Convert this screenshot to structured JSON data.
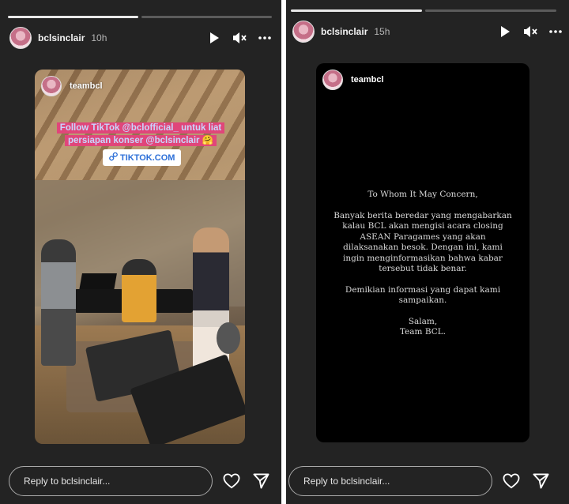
{
  "stories": {
    "left": {
      "username": "bclsinclair",
      "time": "10h",
      "progress_segments_done": 1,
      "progress_segments_total": 2,
      "media": {
        "inner_username": "teambcl",
        "caption_line1": "Follow TikTok @bclofficial_ untuk liat",
        "caption_line2": "persiapan konser @bclsinclair 🤗",
        "link_label": "TIKTOK.COM"
      },
      "reply_placeholder": "Reply to bclsinclair..."
    },
    "right": {
      "username": "bclsinclair",
      "time": "15h",
      "progress_segments_done": 1,
      "progress_segments_total": 2,
      "media": {
        "inner_username": "teambcl",
        "greeting": "To Whom It May Concern,",
        "paragraph1": "Banyak berita beredar yang mengabarkan kalau BCL akan mengisi acara closing ASEAN Paragames yang akan dilaksanakan besok. Dengan ini, kami ingin menginformasikan bahwa kabar tersebut tidak benar.",
        "paragraph2": "Demikian informasi yang dapat kami sampaikan.",
        "closing1": "Salam,",
        "closing2": "Team BCL."
      },
      "reply_placeholder": "Reply to bclsinclair..."
    }
  },
  "icons": {
    "play": "play-icon",
    "mute": "speaker-muted-icon",
    "more": "more-horizontal-icon",
    "heart": "heart-icon",
    "send": "send-icon",
    "link": "link-icon"
  },
  "colors": {
    "background": "#232323",
    "caption_highlight": "#e0467a",
    "link_text": "#2c6fd8"
  }
}
